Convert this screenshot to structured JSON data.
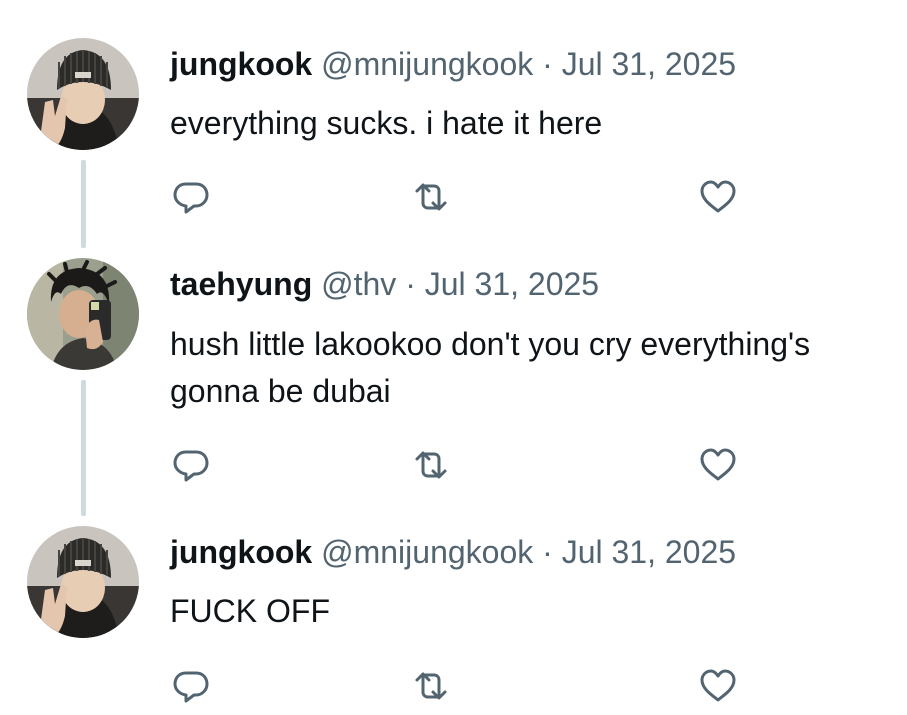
{
  "thread": {
    "tweets": [
      {
        "display_name": "jungkook",
        "meta": "@mnijungkook · Jul 31, 2025",
        "text": "everything sucks. i hate it here",
        "avatar": "beanie-avatar"
      },
      {
        "display_name": "taehyung",
        "meta": "@thv · Jul 31, 2025",
        "text": "hush little lakookoo don't you cry everything's gonna be dubai",
        "avatar": "mirror-selfie-avatar"
      },
      {
        "display_name": "jungkook",
        "meta": "@mnijungkook · Jul 31, 2025",
        "text": "FUCK OFF",
        "avatar": "beanie-avatar"
      }
    ],
    "icons": {
      "reply": "reply-icon",
      "retweet": "retweet-icon",
      "like": "heart-icon"
    },
    "colors": {
      "text": "#0f1419",
      "meta": "#536471",
      "thread_line": "#cfd9de"
    }
  }
}
